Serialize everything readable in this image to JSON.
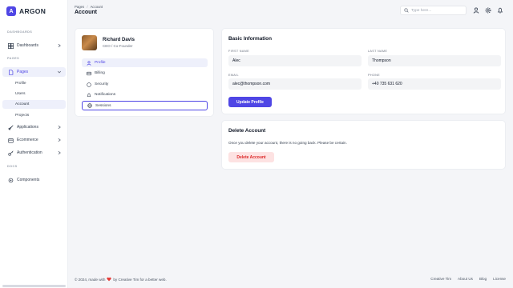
{
  "brand": {
    "logo_letter": "A",
    "name": "ARGON"
  },
  "sidebar": {
    "sections": {
      "dashboards": "DASHBOARDS",
      "pages": "PAGES",
      "docs": "DOCS"
    },
    "dashboards_label": "Dashboards",
    "pages_label": "Pages",
    "pages_sub": [
      "Profile",
      "Users",
      "Account",
      "Projects"
    ],
    "applications_label": "Applications",
    "ecommerce_label": "Ecommerce",
    "authentication_label": "Authentication",
    "components_label": "Components"
  },
  "header": {
    "breadcrumb_root": "Pages",
    "breadcrumb_sep": "/",
    "breadcrumb_current": "Account",
    "title": "Account",
    "search_placeholder": "Type here..."
  },
  "profile": {
    "name": "Richard Davis",
    "role": "CEO / Co-Founder",
    "menu": [
      "Profile",
      "Billing",
      "Security",
      "Notifications",
      "Sessions"
    ]
  },
  "basic_info": {
    "title": "Basic Information",
    "first_name_label": "FIRST NAME",
    "first_name_value": "Alec",
    "last_name_label": "LAST NAME",
    "last_name_value": "Thompson",
    "email_label": "EMAIL",
    "email_value": "alec@thompson.com",
    "phone_label": "PHONE",
    "phone_value": "+40 735 631 620",
    "update_button": "Update Profile"
  },
  "delete_account": {
    "title": "Delete Account",
    "description": "Once you delete your account, there is no going back. Please be certain.",
    "button": "Delete Account"
  },
  "footer": {
    "text_before": "© 2024, made with",
    "text_after": "by Creative Tim for a better web.",
    "links": [
      "Creative Tim",
      "About Us",
      "Blog",
      "License"
    ]
  },
  "colors": {
    "accent": "#4f46e5",
    "danger": "#dc2626",
    "danger_bg": "#fde2e2",
    "heart": "#e53935"
  }
}
